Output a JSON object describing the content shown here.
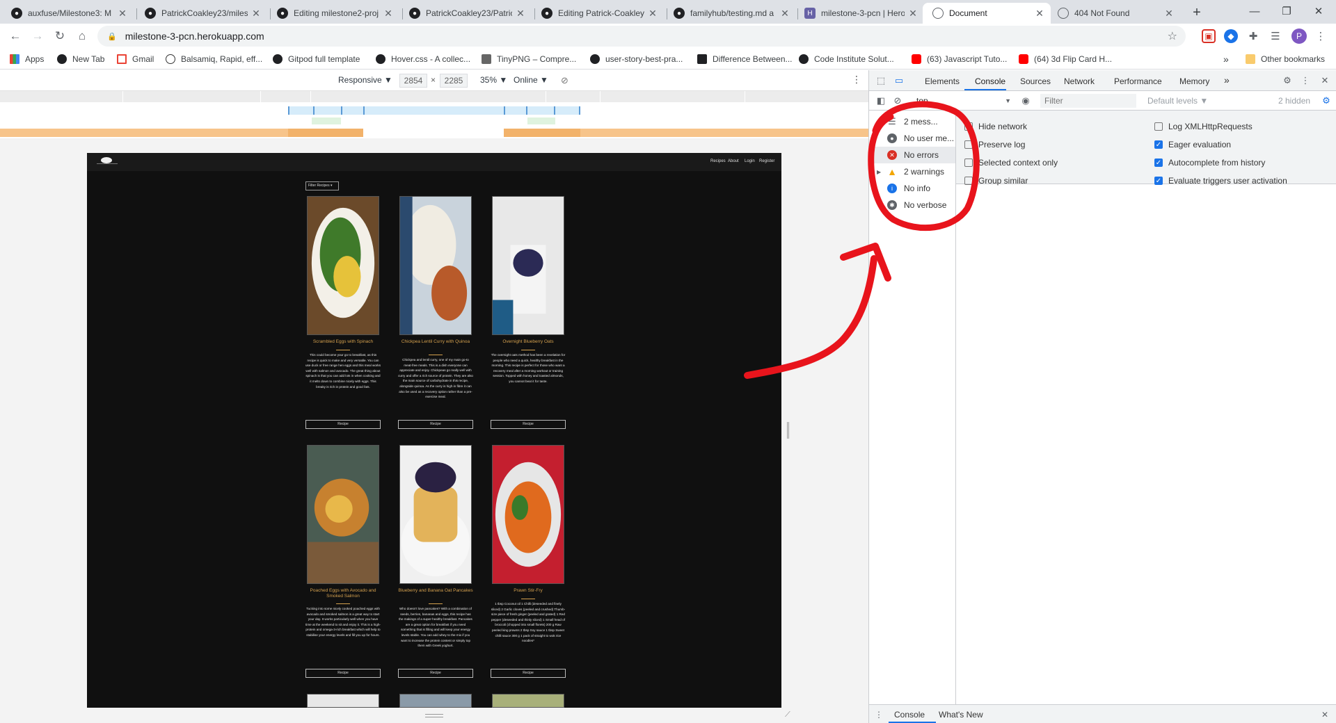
{
  "browser": {
    "tabs": [
      {
        "title": "auxfuse/Milestone3: M",
        "icon": "github-icon"
      },
      {
        "title": "PatrickCoakley23/miles",
        "icon": "github-icon"
      },
      {
        "title": "Editing milestone2-proj",
        "icon": "github-icon"
      },
      {
        "title": "PatrickCoakley23/Patric",
        "icon": "github-icon"
      },
      {
        "title": "Editing Patrick-Coakley",
        "icon": "github-icon"
      },
      {
        "title": "familyhub/testing.md a",
        "icon": "github-icon"
      },
      {
        "title": "milestone-3-pcn | Hero",
        "icon": "heroku-icon"
      },
      {
        "title": "Document",
        "icon": "globe-icon",
        "active": true
      },
      {
        "title": "404 Not Found",
        "icon": "globe-icon"
      }
    ],
    "url": "milestone-3-pcn.herokuapp.com",
    "profile_initial": "P"
  },
  "bookmarks": [
    {
      "label": "Apps",
      "icon": "apps-grid-icon"
    },
    {
      "label": "New Tab",
      "icon": "globe-icon"
    },
    {
      "label": "Gmail",
      "icon": "gmail-icon"
    },
    {
      "label": "Balsamiq, Rapid, eff...",
      "icon": "balsamiq-icon"
    },
    {
      "label": "Gitpod full template",
      "icon": "github-icon"
    },
    {
      "label": "Hover.css - A collec...",
      "icon": "globe-icon"
    },
    {
      "label": "TinyPNG – Compre...",
      "icon": "tinypng-icon"
    },
    {
      "label": "user-story-best-pra...",
      "icon": "github-icon"
    },
    {
      "label": "Difference Between...",
      "icon": "dev-icon"
    },
    {
      "label": "Code Institute Solut...",
      "icon": "github-icon"
    },
    {
      "label": "(63) Javascript Tuto...",
      "icon": "youtube-icon"
    },
    {
      "label": "(64) 3d Flip Card H...",
      "icon": "youtube-icon"
    }
  ],
  "bookmarks_more": "»",
  "other_bookmarks": "Other bookmarks",
  "device_toolbar": {
    "mode": "Responsive ▼",
    "width": "2854",
    "times": "×",
    "height": "2285",
    "zoom": "35% ▼",
    "throttle": "Online ▼"
  },
  "site": {
    "nav_links": [
      "Recipes",
      "About",
      "Login",
      "Register"
    ],
    "filter_label": "Filter Recipes ▾",
    "button_label": "Recipe",
    "recipes": [
      {
        "title": "Scrambled Eggs with Spinach",
        "description": "This could become your go to breakfast, as this recipe is quick to make and very versatile. You can use duck or free range hen eggs and this meal works well with salmon and avocado. The great thing about spinach is that you can add lots in when cooking and it melts down to combine nicely with eggs. This breaky is rich in protein and good fats.",
        "image_colors": [
          "#6b4a2a",
          "#f3f0e8",
          "#3f7a2a",
          "#e6c23a"
        ]
      },
      {
        "title": "Chickpea Lentil Curry with Quinoa",
        "description": "Chickpea and lentil curry, one of my main go-to meat-free meals. This is a dish everyone can appreciate and enjoy. Chickpeas go really well with curry and offer a rich source of protein. They are also the main source of carbohydrate in this recipe, alongside quinoa. As the curry is high in fibre it can also be used as a recovery option rather than a pre-exercise meal.",
        "image_colors": [
          "#c9d3dc",
          "#f0ece2",
          "#b85a2a",
          "#2b4a6e"
        ]
      },
      {
        "title": "Overnight Blueberry Oats",
        "description": "The overnight oats method has been a revelation for people who need a quick, healthy breakfast in the morning. This recipe is perfect for those who want a recovery meal after a morning workout or training session. Topped with honey and toasted almonds, you cannot beat it for taste.",
        "image_colors": [
          "#e8e8e8",
          "#f4f4f4",
          "#2b2a55",
          "#1f5c86"
        ]
      },
      {
        "title": "Poached Eggs with Avocado and Smoked Salmon",
        "description": "Tucking into some nicely cooked poached eggs with avocado and smoked salmon is a great way to start your day. It works particularly well when you have time at the weekend to sit and enjoy it. This is a high-protein and omega-3-rich breakfast which will help to stabilise your energy levels and fill you up for hours.",
        "image_colors": [
          "#4a5c52",
          "#c7812f",
          "#e8b84a",
          "#7a5a3a"
        ]
      },
      {
        "title": "Blueberry and Banana Oat Pancakes",
        "description": "Who doesn't love pancakes? With a combination of seeds, berries, bananas and eggs, this recipe has the makings of a super-healthy breakfast. Pancakes are a great option for breakfast if you need something that is filling and will keep your energy levels stable. You can add whey to the mix if you want to increase the protein content or simply top them with Greek yoghurt.",
        "image_colors": [
          "#f0f0f0",
          "#2a2142",
          "#e3b35a",
          "#f7f7f7"
        ]
      },
      {
        "title": "Prawn Stir-Fry",
        "description": "1 tbsp Coconut oil 1 Chilli (deseeded and finely sliced) 2 Garlic cloves (peeled and crushed) Thumb-size piece of fresh ginger (peeled and grated) 1 Red pepper (deseeded and thinly sliced) 1 Small head of broccoli (chopped into small florets) 200 g Raw peeled king prawns 2 tbsp Soy sauce 1 tbsp Sweet chilli sauce 300 g 1 pack of straight to wok rice noodles*",
        "image_colors": [
          "#c41f2f",
          "#e6e6e6",
          "#e06a1e",
          "#3a7a2a"
        ]
      }
    ]
  },
  "devtools": {
    "tabs": [
      "Elements",
      "Console",
      "Sources",
      "Network",
      "Performance",
      "Memory"
    ],
    "active_tab": "Console",
    "more_tabs": "»",
    "context": "top",
    "filter_placeholder": "Filter",
    "levels": "Default levels ▼",
    "hidden": "2 hidden",
    "sidebar": [
      {
        "label": "2 mess...",
        "icon": "list-icon"
      },
      {
        "label": "No user me...",
        "icon": "user-icon"
      },
      {
        "label": "No errors",
        "icon": "error-icon",
        "selected": true
      },
      {
        "label": "2 warnings",
        "icon": "warning-icon"
      },
      {
        "label": "No info",
        "icon": "info-icon"
      },
      {
        "label": "No verbose",
        "icon": "bug-icon"
      }
    ],
    "options_left": [
      {
        "label": "Hide network",
        "checked": false
      },
      {
        "label": "Preserve log",
        "checked": false
      },
      {
        "label": "Selected context only",
        "checked": false
      },
      {
        "label": "Group similar",
        "checked": false
      }
    ],
    "options_right": [
      {
        "label": "Log XMLHttpRequests",
        "checked": false
      },
      {
        "label": "Eager evaluation",
        "checked": true
      },
      {
        "label": "Autocomplete from history",
        "checked": true
      },
      {
        "label": "Evaluate triggers user activation",
        "checked": true
      }
    ],
    "drawer_tabs": [
      "Console",
      "What's New"
    ]
  },
  "colors": {
    "annotation_red": "#e8141c",
    "accent_blue": "#1a73e8",
    "recipe_title": "#d4a04e",
    "site_bg": "#101010"
  }
}
